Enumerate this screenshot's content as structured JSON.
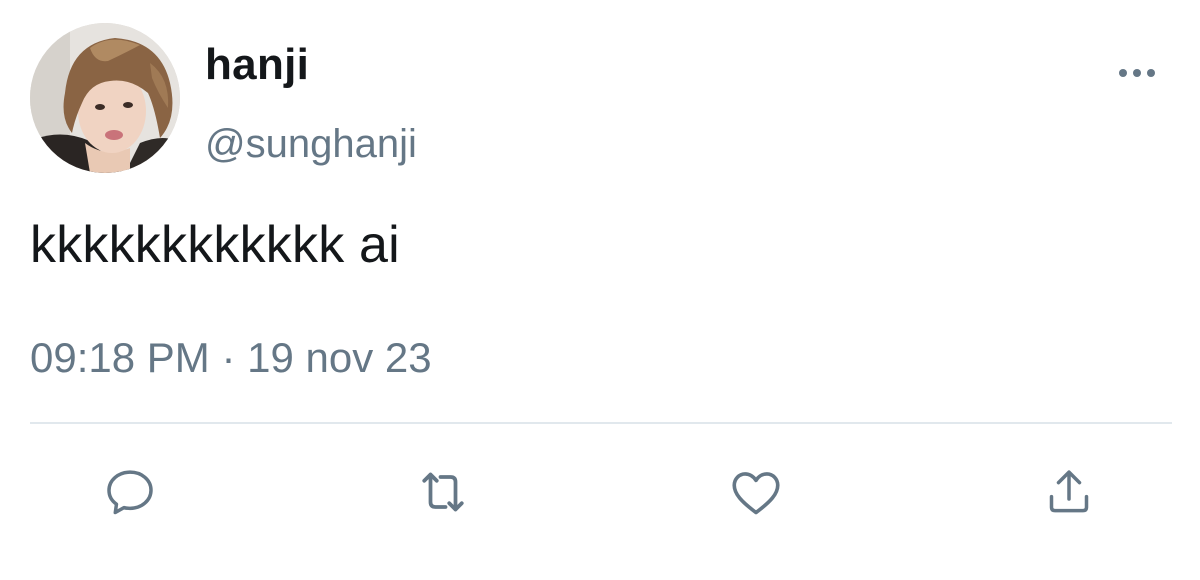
{
  "tweet": {
    "display_name": "hanji",
    "handle": "@sunghanji",
    "text": "kkkkkkkkkkkk ai",
    "timestamp": "09:18 PM · 19 nov 23"
  },
  "actions": {
    "more_icon": "more-horizontal-icon",
    "reply_icon": "reply-bubble-icon",
    "retweet_icon": "retweet-icon",
    "like_icon": "heart-icon",
    "share_icon": "share-upload-icon"
  },
  "colors": {
    "primary_text": "#14171a",
    "secondary_text": "#657786",
    "icon": "#657786",
    "divider": "#e1e8ed"
  }
}
